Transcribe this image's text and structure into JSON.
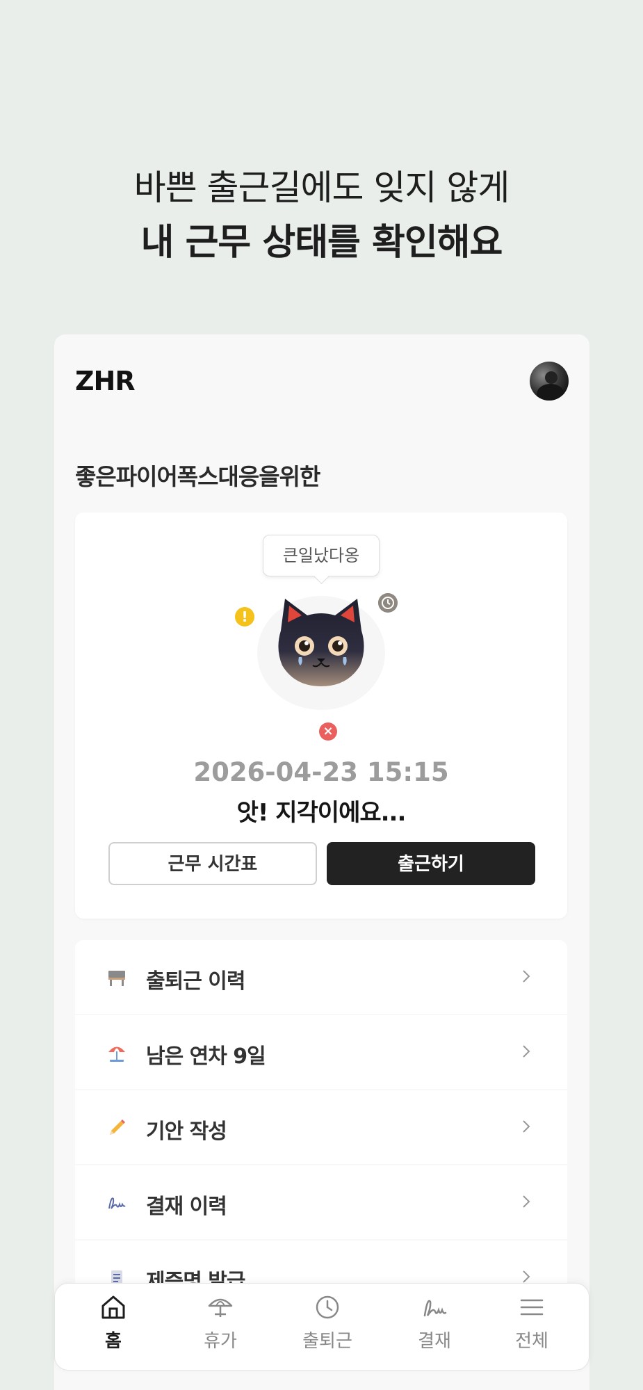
{
  "hero": {
    "line1": "바쁜 출근길에도 잊지 않게",
    "line2": "내 근무 상태를 확인해요"
  },
  "app": {
    "logo": "ZHR",
    "company": "좋은파이어폭스대응을위한"
  },
  "status_card": {
    "bubble_text": "큰일났다옹",
    "datetime": "2026-04-23 15:15",
    "status_text": "앗! 지각이에요...",
    "schedule_button": "근무 시간표",
    "checkin_button": "출근하기"
  },
  "menu": {
    "items": [
      {
        "label": "출퇴근 이력",
        "icon": "desk-icon"
      },
      {
        "label": "남은 연차 9일",
        "icon": "beach-umbrella-icon"
      },
      {
        "label": "기안 작성",
        "icon": "pencil-icon"
      },
      {
        "label": "결재 이력",
        "icon": "signature-icon"
      },
      {
        "label": "제증명 발급",
        "icon": "document-icon"
      }
    ]
  },
  "tabbar": {
    "tabs": [
      {
        "label": "홈",
        "icon": "home-icon",
        "active": true
      },
      {
        "label": "휴가",
        "icon": "umbrella-icon",
        "active": false
      },
      {
        "label": "출퇴근",
        "icon": "clock-icon",
        "active": false
      },
      {
        "label": "결재",
        "icon": "signature-icon",
        "active": false
      },
      {
        "label": "전체",
        "icon": "menu-icon",
        "active": false
      }
    ]
  },
  "colors": {
    "background": "#e9eeea",
    "primary_button": "#222222",
    "warning": "#f5c21b",
    "error": "#e9605e"
  }
}
